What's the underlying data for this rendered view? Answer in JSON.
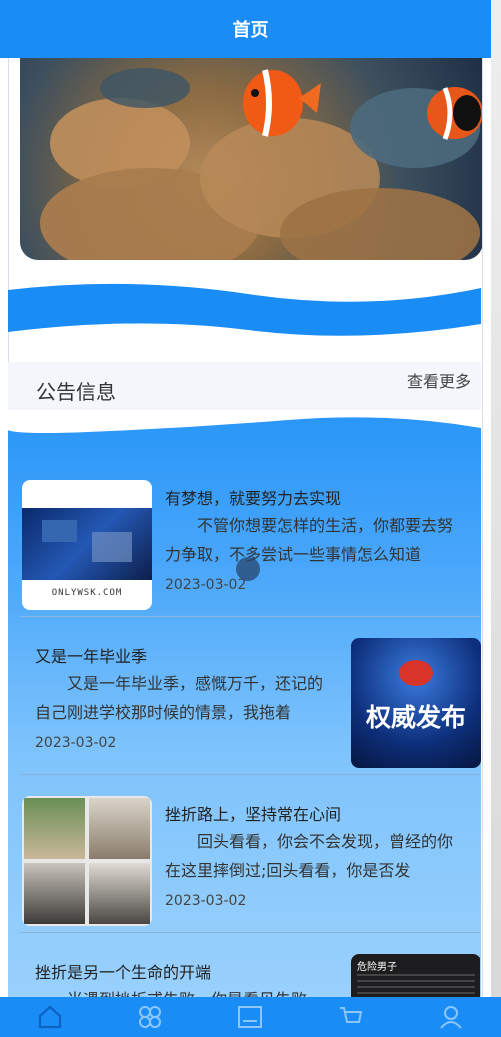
{
  "header": {
    "title": "首页"
  },
  "notice": {
    "title": "公告信息",
    "more": "查看更多"
  },
  "news": [
    {
      "title": "有梦想，就要努力去实现",
      "desc": "不管你想要怎样的生活，你都要去努力争取，不多尝试一些事情怎么知道",
      "date": "2023-03-02",
      "thumb_text": "ONLYWSK.COM"
    },
    {
      "title": "又是一年毕业季",
      "desc": "又是一年毕业季，感慨万千，还记的自己刚进学校那时候的情景，我拖着",
      "date": "2023-03-02",
      "thumb_text": "权威发布"
    },
    {
      "title": "挫折路上，坚持常在心间",
      "desc": "回头看看，你会不会发现，曾经的你在这里摔倒过;回头看看，你是否发",
      "date": "2023-03-02"
    },
    {
      "title": "挫折是另一个生命的开端",
      "desc": "当遇到挫折或失败，你是看见失败",
      "thumb_text": "危险男子"
    }
  ],
  "tabs": [
    {
      "icon": "home-icon"
    },
    {
      "icon": "category-icon"
    },
    {
      "icon": "news-icon"
    },
    {
      "icon": "cart-icon"
    },
    {
      "icon": "user-icon"
    }
  ],
  "colors": {
    "primary": "#1a8cf6"
  }
}
